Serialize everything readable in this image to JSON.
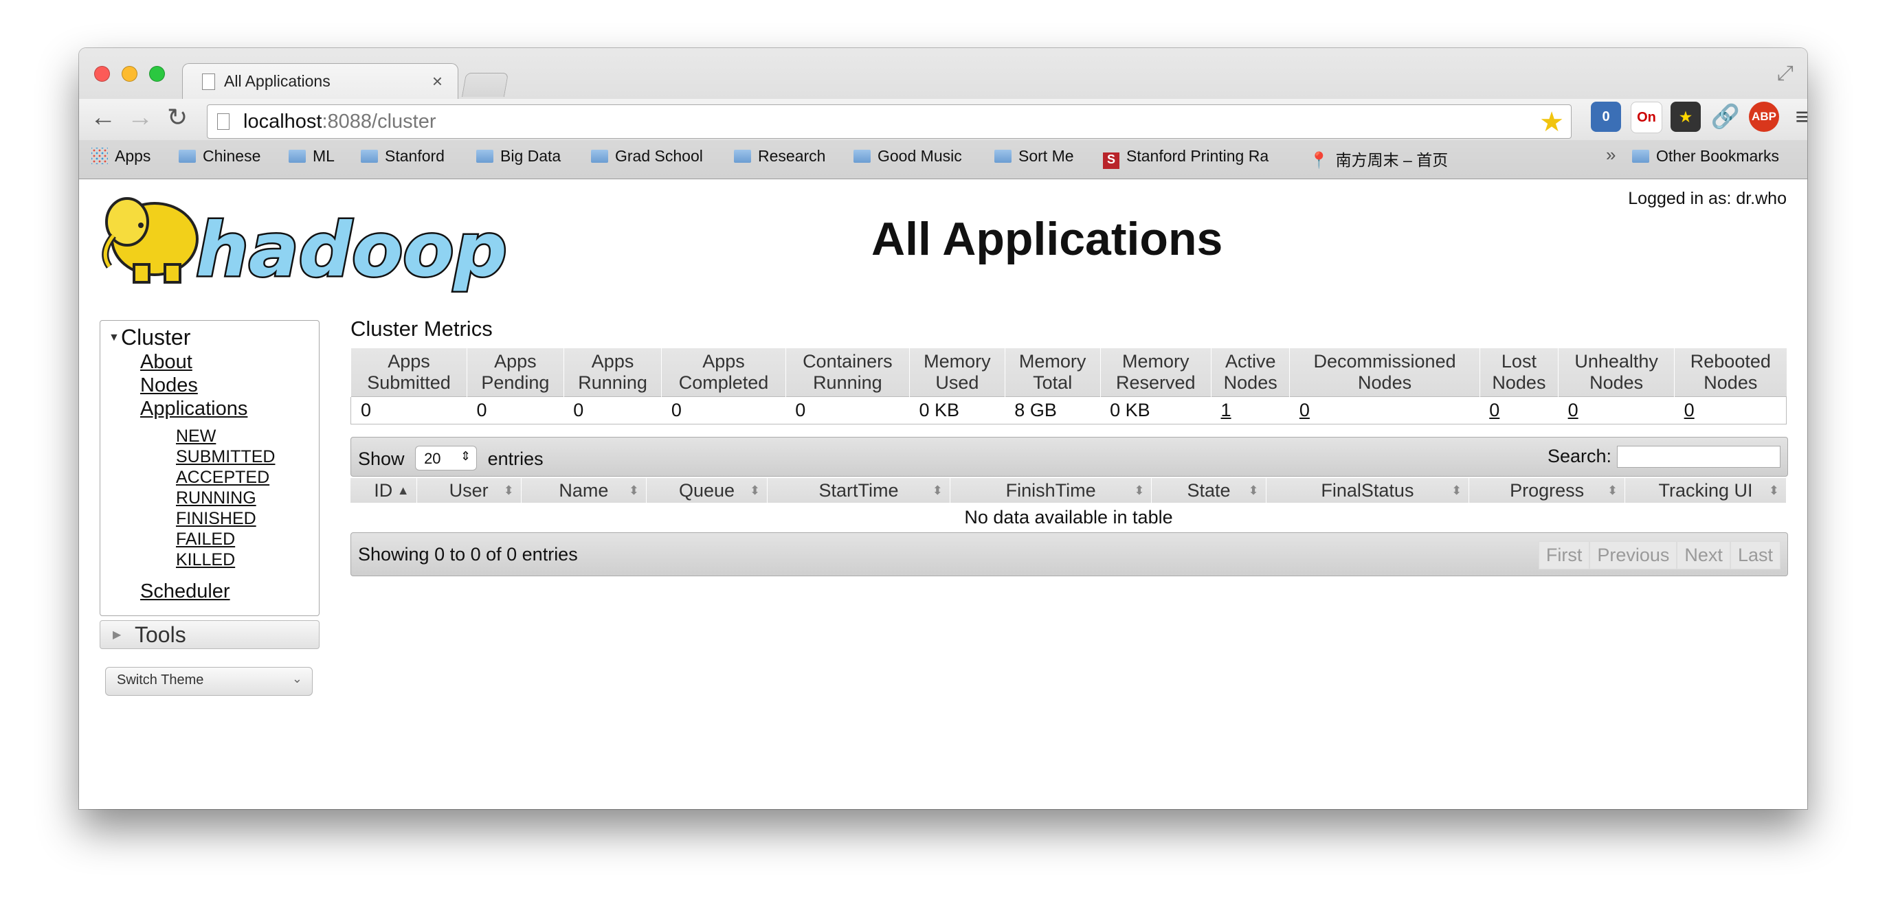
{
  "browser": {
    "tab_title": "All Applications",
    "tab_close": "×",
    "url_host": "localhost",
    "url_rest": ":8088/cluster",
    "bookmarks": [
      "Apps",
      "Chinese",
      "ML",
      "Stanford",
      "Big Data",
      "Grad School",
      "Research",
      "Good Music",
      "Sort Me",
      "Stanford Printing Ra",
      "南方周末 – 首页"
    ],
    "more": "»",
    "other_bookmarks": "Other Bookmarks",
    "ext_ghost_badge": "0",
    "ext_zhong_badge": "On",
    "ext_abp": "ABP"
  },
  "header": {
    "logged_in": "Logged in as: dr.who",
    "title": "All Applications",
    "logo_text": "hadoop"
  },
  "sidebar": {
    "cluster_label": "Cluster",
    "links": [
      "About",
      "Nodes",
      "Applications"
    ],
    "states": [
      "NEW",
      "SUBMITTED",
      "ACCEPTED",
      "RUNNING",
      "FINISHED",
      "FAILED",
      "KILLED"
    ],
    "scheduler": "Scheduler",
    "tools_label": "Tools",
    "switch_theme": "Switch Theme"
  },
  "metrics": {
    "title": "Cluster Metrics",
    "headers": [
      [
        "Apps",
        "Submitted"
      ],
      [
        "Apps",
        "Pending"
      ],
      [
        "Apps",
        "Running"
      ],
      [
        "Apps",
        "Completed"
      ],
      [
        "Containers",
        "Running"
      ],
      [
        "Memory",
        "Used"
      ],
      [
        "Memory",
        "Total"
      ],
      [
        "Memory",
        "Reserved"
      ],
      [
        "Active",
        "Nodes"
      ],
      [
        "Decommissioned",
        "Nodes"
      ],
      [
        "Lost",
        "Nodes"
      ],
      [
        "Unhealthy",
        "Nodes"
      ],
      [
        "Rebooted",
        "Nodes"
      ]
    ],
    "values": [
      "0",
      "0",
      "0",
      "0",
      "0",
      "0 KB",
      "8 GB",
      "0 KB",
      "1",
      "0",
      "0",
      "0",
      "0"
    ]
  },
  "apps_table": {
    "show_label": "Show",
    "entries_value": "20",
    "entries_label": "entries",
    "search_label": "Search:",
    "columns": [
      "ID",
      "User",
      "Name",
      "Queue",
      "StartTime",
      "FinishTime",
      "State",
      "FinalStatus",
      "Progress",
      "Tracking UI"
    ],
    "empty_message": "No data available in table",
    "info": "Showing 0 to 0 of 0 entries",
    "pager": [
      "First",
      "Previous",
      "Next",
      "Last"
    ]
  }
}
